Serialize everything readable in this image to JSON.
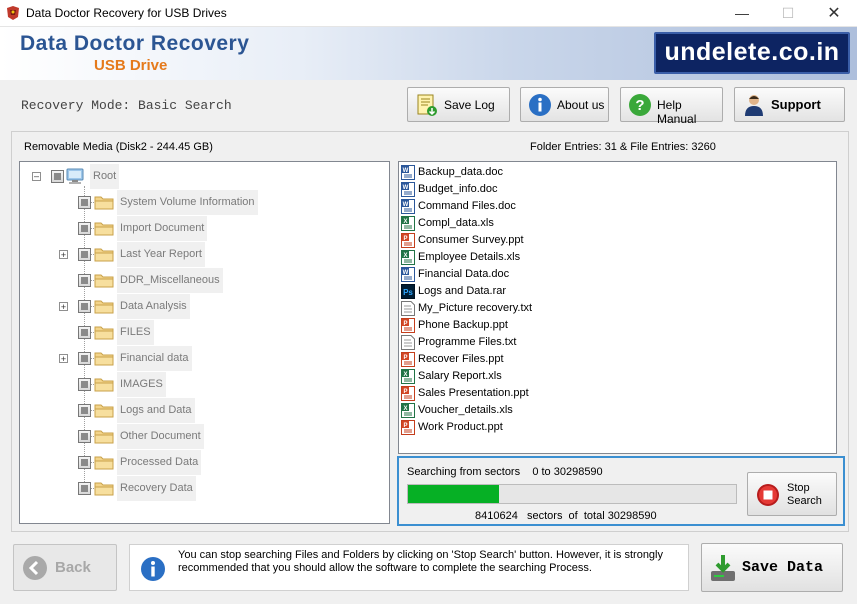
{
  "window": {
    "title": "Data Doctor Recovery for USB Drives",
    "minimize": "—",
    "maximize": "☐",
    "close": "✕"
  },
  "banner": {
    "title": "Data Doctor Recovery",
    "subtitle": "USB Drive",
    "url": "undelete.co.in"
  },
  "toolbar": {
    "mode": "Recovery Mode: Basic Search",
    "save_log": "Save Log",
    "about": "About us",
    "help": "Help Manual",
    "support": "Support"
  },
  "media": {
    "label": "Removable Media (Disk2 - 244.45 GB)",
    "entries": "Folder Entries: 31 & File Entries: 3260"
  },
  "tree": {
    "root": "Root",
    "folders": [
      {
        "label": "System Volume Information",
        "expandable": false
      },
      {
        "label": "Import Document",
        "expandable": false
      },
      {
        "label": "Last Year Report",
        "expandable": true
      },
      {
        "label": "DDR_Miscellaneous",
        "expandable": false
      },
      {
        "label": "Data Analysis",
        "expandable": true
      },
      {
        "label": "FILES",
        "expandable": false
      },
      {
        "label": "Financial data",
        "expandable": true
      },
      {
        "label": "IMAGES",
        "expandable": false
      },
      {
        "label": "Logs and Data",
        "expandable": false
      },
      {
        "label": "Other Document",
        "expandable": false
      },
      {
        "label": "Processed Data",
        "expandable": false
      },
      {
        "label": "Recovery Data",
        "expandable": false
      }
    ]
  },
  "files": [
    {
      "name": "Backup_data.doc",
      "type": "doc"
    },
    {
      "name": "Budget_info.doc",
      "type": "doc"
    },
    {
      "name": "Command Files.doc",
      "type": "doc"
    },
    {
      "name": "Compl_data.xls",
      "type": "xls"
    },
    {
      "name": "Consumer Survey.ppt",
      "type": "ppt"
    },
    {
      "name": "Employee Details.xls",
      "type": "xls"
    },
    {
      "name": "Financial Data.doc",
      "type": "doc"
    },
    {
      "name": "Logs and Data.rar",
      "type": "rar"
    },
    {
      "name": "My_Picture recovery.txt",
      "type": "txt"
    },
    {
      "name": "Phone Backup.ppt",
      "type": "ppt"
    },
    {
      "name": "Programme Files.txt",
      "type": "txt"
    },
    {
      "name": "Recover Files.ppt",
      "type": "ppt"
    },
    {
      "name": "Salary Report.xls",
      "type": "xls"
    },
    {
      "name": "Sales Presentation.ppt",
      "type": "ppt"
    },
    {
      "name": "Voucher_details.xls",
      "type": "xls"
    },
    {
      "name": "Work Product.ppt",
      "type": "ppt"
    }
  ],
  "progress": {
    "search_text": "Searching from sectors    0 to 30298590",
    "fraction": 0.2776,
    "sectors_text": "8410624   sectors  of  total 30298590",
    "stop_label": "Stop Search",
    "bar_color": "#06b025"
  },
  "bottom": {
    "back": "Back",
    "info": "You can stop searching Files and Folders by clicking on 'Stop Search' button. However, it is strongly recommended that you should allow the software to complete the searching Process.",
    "save": "Save Data"
  },
  "icons": {
    "app": "data-doctor-icon",
    "save_log": "save-log-icon",
    "about": "info-icon",
    "help": "help-icon",
    "support": "support-person-icon",
    "root": "drive-icon",
    "folder": "folder-icon",
    "stop": "stop-icon",
    "back": "back-arrow-icon",
    "info": "info-icon",
    "save": "save-data-icon"
  }
}
